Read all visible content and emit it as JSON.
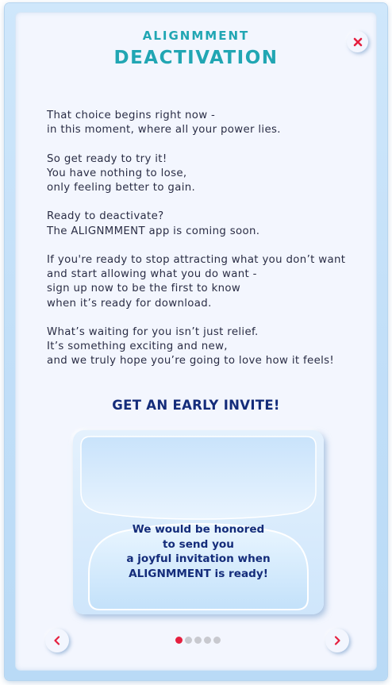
{
  "header": {
    "title_top": "ALIGNMMENT",
    "title_main": "DEACTIVATION"
  },
  "body_paragraphs": [
    {
      "lines": [
        "That choice begins right now -",
        "in this moment, where all your power lies."
      ]
    },
    {
      "lines": [
        "So get ready to try it!",
        "You have nothing to lose,",
        "only feeling better to gain."
      ]
    },
    {
      "lines": [
        "Ready to deactivate?",
        "The ALIGNMMENT app is coming soon."
      ]
    },
    {
      "lines": [
        "If you're ready to stop attracting what you don’t want",
        "and start allowing what you do want -",
        "sign up now to be the first to know",
        "when it’s ready for download."
      ]
    },
    {
      "lines": [
        "What’s waiting for you isn’t just relief.",
        "It’s something exciting and new,",
        "and we truly hope you’re going to love how it feels!"
      ]
    }
  ],
  "cta": {
    "label": "GET AN EARLY INVITE!"
  },
  "invite_card": {
    "lines": [
      "We would be honored",
      "to send you",
      "a joyful invitation when",
      "ALIGNMMENT is ready!"
    ]
  },
  "pagination": {
    "total": 5,
    "current": 1
  },
  "icons": {
    "close": "close-icon",
    "prev": "chevron-left-icon",
    "next": "chevron-right-icon"
  },
  "colors": {
    "accent_teal": "#21a6b3",
    "heading_navy": "#142c7a",
    "icon_red": "#e51f3f",
    "card_background": "#f3f6fe"
  }
}
